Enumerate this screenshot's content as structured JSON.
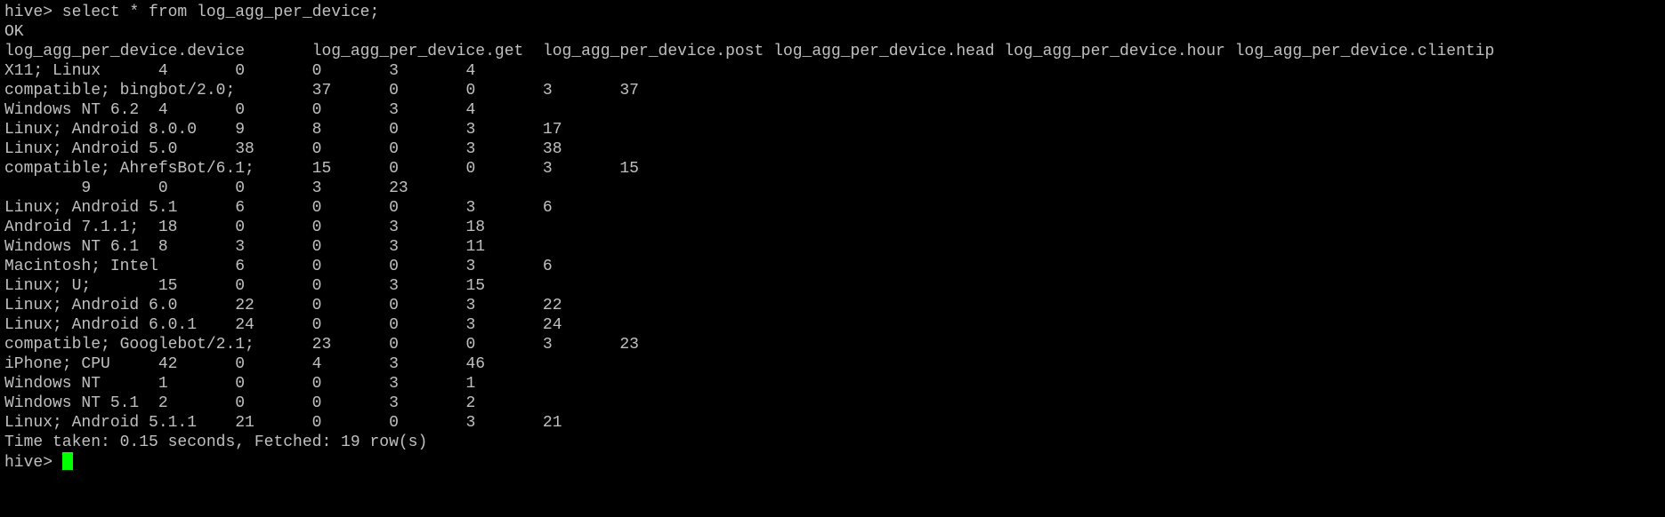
{
  "terminal": {
    "colors": {
      "background": "#000000",
      "foreground": "#c0c0c0",
      "cursor": "#00ff00"
    },
    "lines": [
      "hive> select * from log_agg_per_device;",
      "OK",
      "log_agg_per_device.device       log_agg_per_device.get  log_agg_per_device.post log_agg_per_device.head log_agg_per_device.hour log_agg_per_device.clientip",
      "X11; Linux      4       0       0       3       4",
      "compatible; bingbot/2.0;        37      0       0       3       37",
      "Windows NT 6.2  4       0       0       3       4",
      "Linux; Android 8.0.0    9       8       0       3       17",
      "Linux; Android 5.0      38      0       0       3       38",
      "compatible; AhrefsBot/6.1;      15      0       0       3       15",
      "        9       0       0       3       23",
      "Linux; Android 5.1      6       0       0       3       6",
      "Android 7.1.1;  18      0       0       3       18",
      "Windows NT 6.1  8       3       0       3       11",
      "Macintosh; Intel        6       0       0       3       6",
      "Linux; U;       15      0       0       3       15",
      "Linux; Android 6.0      22      0       0       3       22",
      "Linux; Android 6.0.1    24      0       0       3       24",
      "compatible; Googlebot/2.1;      23      0       0       3       23",
      "iPhone; CPU     42      0       4       3       46",
      "Windows NT      1       0       0       3       1",
      "Windows NT 5.1  2       0       0       3       2",
      "Linux; Android 5.1.1    21      0       0       3       21",
      "Time taken: 0.15 seconds, Fetched: 19 row(s)"
    ],
    "prompt": "hive> "
  }
}
